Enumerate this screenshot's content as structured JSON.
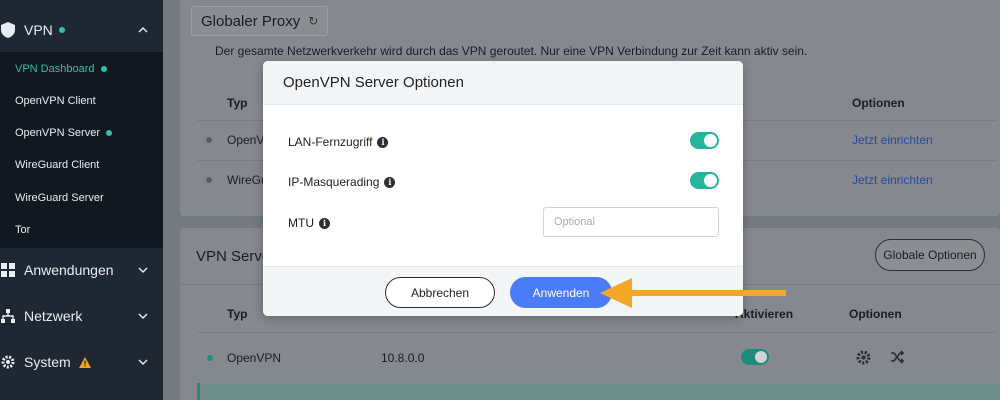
{
  "sidebar": {
    "vpn": {
      "label": "VPN"
    },
    "vpn_items": [
      {
        "label": "VPN Dashboard"
      },
      {
        "label": "OpenVPN Client"
      },
      {
        "label": "OpenVPN Server"
      },
      {
        "label": "WireGuard Client"
      },
      {
        "label": "WireGuard Server"
      },
      {
        "label": "Tor"
      }
    ],
    "sections": [
      {
        "label": "Anwendungen"
      },
      {
        "label": "Netzwerk"
      },
      {
        "label": "System"
      }
    ]
  },
  "proxy": {
    "label": "Globaler Proxy",
    "description": "Der gesamte Netzwerkverkehr wird durch das VPN geroutet. Nur eine VPN Verbindung zur Zeit kann aktiv sein."
  },
  "client_table": {
    "col_type": "Typ",
    "col_options": "Optionen",
    "rows": [
      {
        "type": "OpenVP",
        "action": "Jetzt einrichten"
      },
      {
        "type": "WireGu",
        "action": "Jetzt einrichten"
      }
    ]
  },
  "server_card": {
    "title": "VPN Serve",
    "global_options": "Globale Optionen",
    "col_type": "Typ",
    "col_activate": "Aktivieren",
    "col_options": "Optionen",
    "row": {
      "type": "OpenVPN",
      "subnet": "10.8.0.0"
    }
  },
  "modal": {
    "title": "OpenVPN Server Optionen",
    "lan_access": "LAN-Fernzugriff",
    "ip_masq": "IP-Masquerading",
    "mtu": "MTU",
    "mtu_placeholder": "Optional",
    "cancel": "Abbrechen",
    "apply": "Anwenden"
  },
  "colors": {
    "accent_teal": "#23b69b",
    "primary_blue": "#4a7cf7",
    "annotation_orange": "#f5a623"
  }
}
